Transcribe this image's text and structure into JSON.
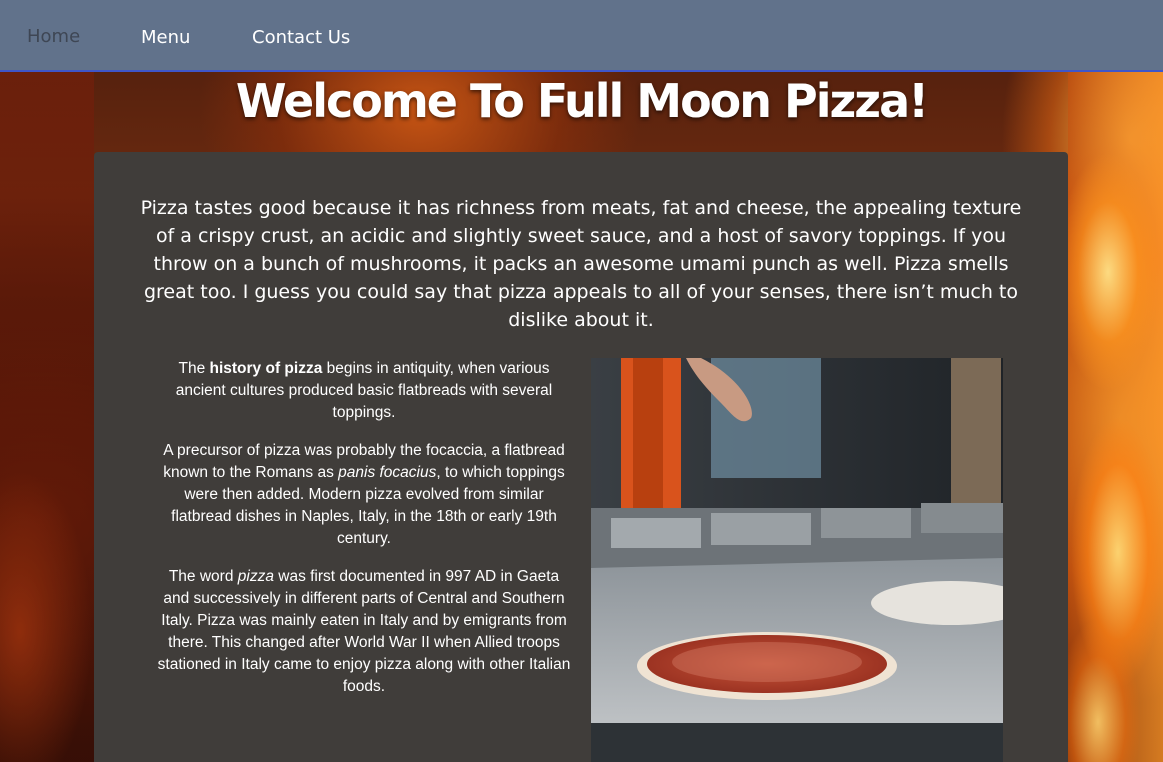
{
  "nav": {
    "items": [
      {
        "label": "Home",
        "active": true
      },
      {
        "label": "Menu",
        "active": false
      },
      {
        "label": "Contact Us",
        "active": false
      }
    ]
  },
  "header": {
    "title": "Welcome To Full Moon Pizza!"
  },
  "main": {
    "intro": "Pizza tastes good because it has richness from meats, fat and cheese, the appealing texture of a crispy crust, an acidic and slightly sweet sauce, and a host of savory toppings. If you throw on a bunch of mushrooms, it packs an awesome umami punch as well. Pizza smells great too. I guess you could say that pizza appeals to all of your senses, there isn’t much to dislike about it.",
    "history": {
      "p1_before": "The ",
      "p1_bold": "history of pizza",
      "p1_after": " begins in antiquity, when various ancient cultures produced basic flatbreads with several toppings.",
      "p2_before": "A precursor of pizza was probably the focaccia, a flatbread known to the Romans as ",
      "p2_italic": "panis focacius",
      "p2_after": ", to which toppings were then added. Modern pizza evolved from similar flatbread dishes in Naples, Italy, in the 18th or early 19th century.",
      "p3_before": "The word ",
      "p3_italic": "pizza",
      "p3_after": " was first documented in 997 AD in Gaeta and successively in different parts of Central and Southern Italy. Pizza was mainly eaten in Italy and by emigrants from there. This changed after World War II when Allied troops stationed in Italy came to enjoy pizza along with other Italian foods."
    }
  },
  "colors": {
    "nav_bg": "#61728b",
    "nav_active": "#3e4654",
    "nav_border": "#3f56c9",
    "panel_bg": "#403d3a",
    "text": "#ffffff"
  }
}
